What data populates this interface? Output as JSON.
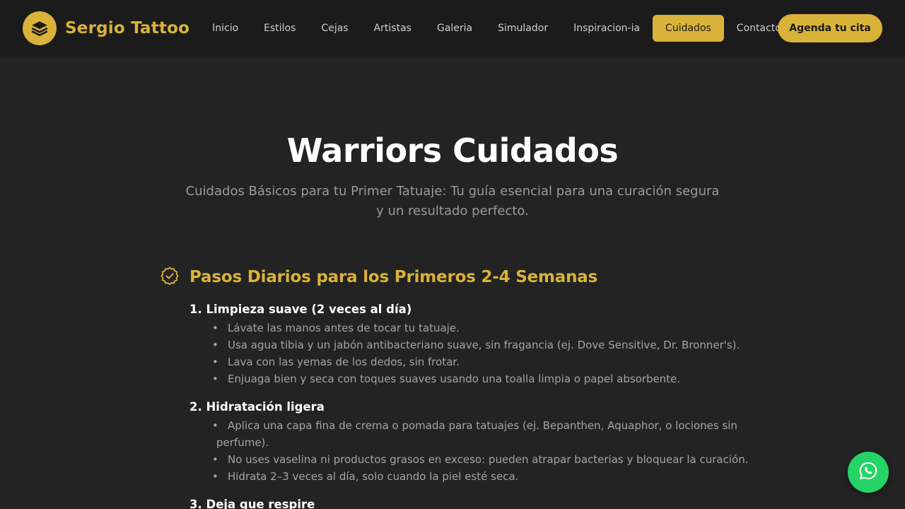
{
  "header": {
    "brand_name": "Sergio Tattoo",
    "logo_icon": "layers-icon",
    "nav": [
      {
        "label": "Inicio"
      },
      {
        "label": "Estilos"
      },
      {
        "label": "Cejas"
      },
      {
        "label": "Artistas"
      },
      {
        "label": "Galeria"
      },
      {
        "label": "Simulador"
      },
      {
        "label": "Inspiracion-ia"
      },
      {
        "label": "Cuidados",
        "active": true
      },
      {
        "label": "Contacto"
      }
    ],
    "cta_label": "Agenda tu cita"
  },
  "hero": {
    "title": "Warriors Cuidados",
    "subtitle": "Cuidados Básicos para tu Primer Tatuaje: Tu guía esencial para una curación segura y un resultado perfecto."
  },
  "section": {
    "icon": "check-badge-icon",
    "title": "Pasos Diarios para los Primeros 2-4 Semanas",
    "steps": [
      {
        "title": "1. Limpieza suave (2 veces al día)",
        "items": [
          "Lávate las manos antes de tocar tu tatuaje.",
          "Usa agua tibia y un jabón antibacteriano suave, sin fragancia (ej. Dove Sensitive, Dr. Bronner's).",
          "Lava con las yemas de los dedos, sin frotar.",
          "Enjuaga bien y seca con toques suaves usando una toalla limpia o papel absorbente."
        ]
      },
      {
        "title": "2. Hidratación ligera",
        "items": [
          "Aplica una capa fina de crema o pomada para tatuajes (ej. Bepanthen, Aquaphor, o lociones sin perfume).",
          "No uses vaselina ni productos grasos en exceso: pueden atrapar bacterias y bloquear la curación.",
          "Hidrata 2–3 veces al día, solo cuando la piel esté seca."
        ]
      },
      {
        "title": "3. Deja que respire",
        "items": []
      }
    ]
  },
  "floating": {
    "whatsapp_icon": "whatsapp-icon"
  },
  "colors": {
    "accent": "#d9b23a",
    "background": "#232323",
    "header": "#1b1b1b",
    "whatsapp": "#25d366"
  }
}
